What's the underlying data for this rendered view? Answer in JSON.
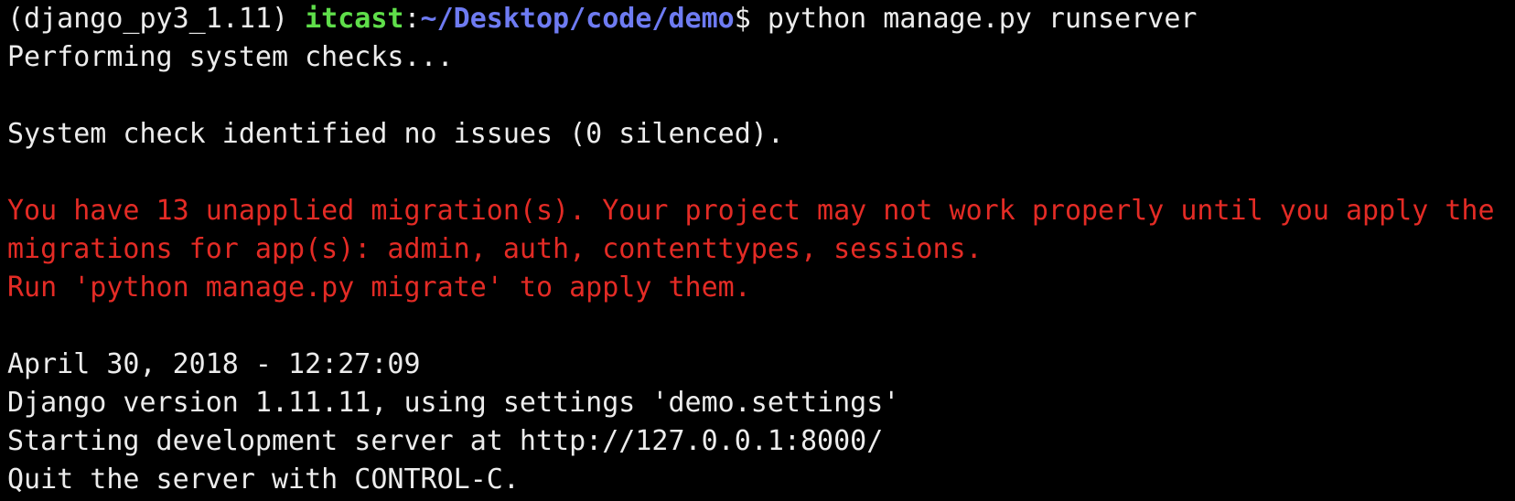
{
  "colors": {
    "background": "#000000",
    "foreground": "#ececec",
    "error": "#e32b25",
    "prompt_user": "#5fde4a",
    "prompt_path": "#6e7bf2"
  },
  "prompt": {
    "env": "(django_py3_1.11) ",
    "user": "itcast",
    "separator": ":",
    "path": "~/Desktop/code/demo",
    "symbol": "$ ",
    "command": "python manage.py runserver"
  },
  "output": {
    "performing": "Performing system checks...",
    "check_result": "System check identified no issues (0 silenced).",
    "warning_1": "You have 13 unapplied migration(s). Your project may not work properly until you apply the",
    "warning_2": "migrations for app(s): admin, auth, contenttypes, sessions.",
    "warning_3": "Run 'python manage.py migrate' to apply them.",
    "timestamp": "April 30, 2018 - 12:27:09",
    "django_version": "Django version 1.11.11, using settings 'demo.settings'",
    "server_start": "Starting development server at http://127.0.0.1:8000/",
    "quit_hint": "Quit the server with CONTROL-C."
  }
}
